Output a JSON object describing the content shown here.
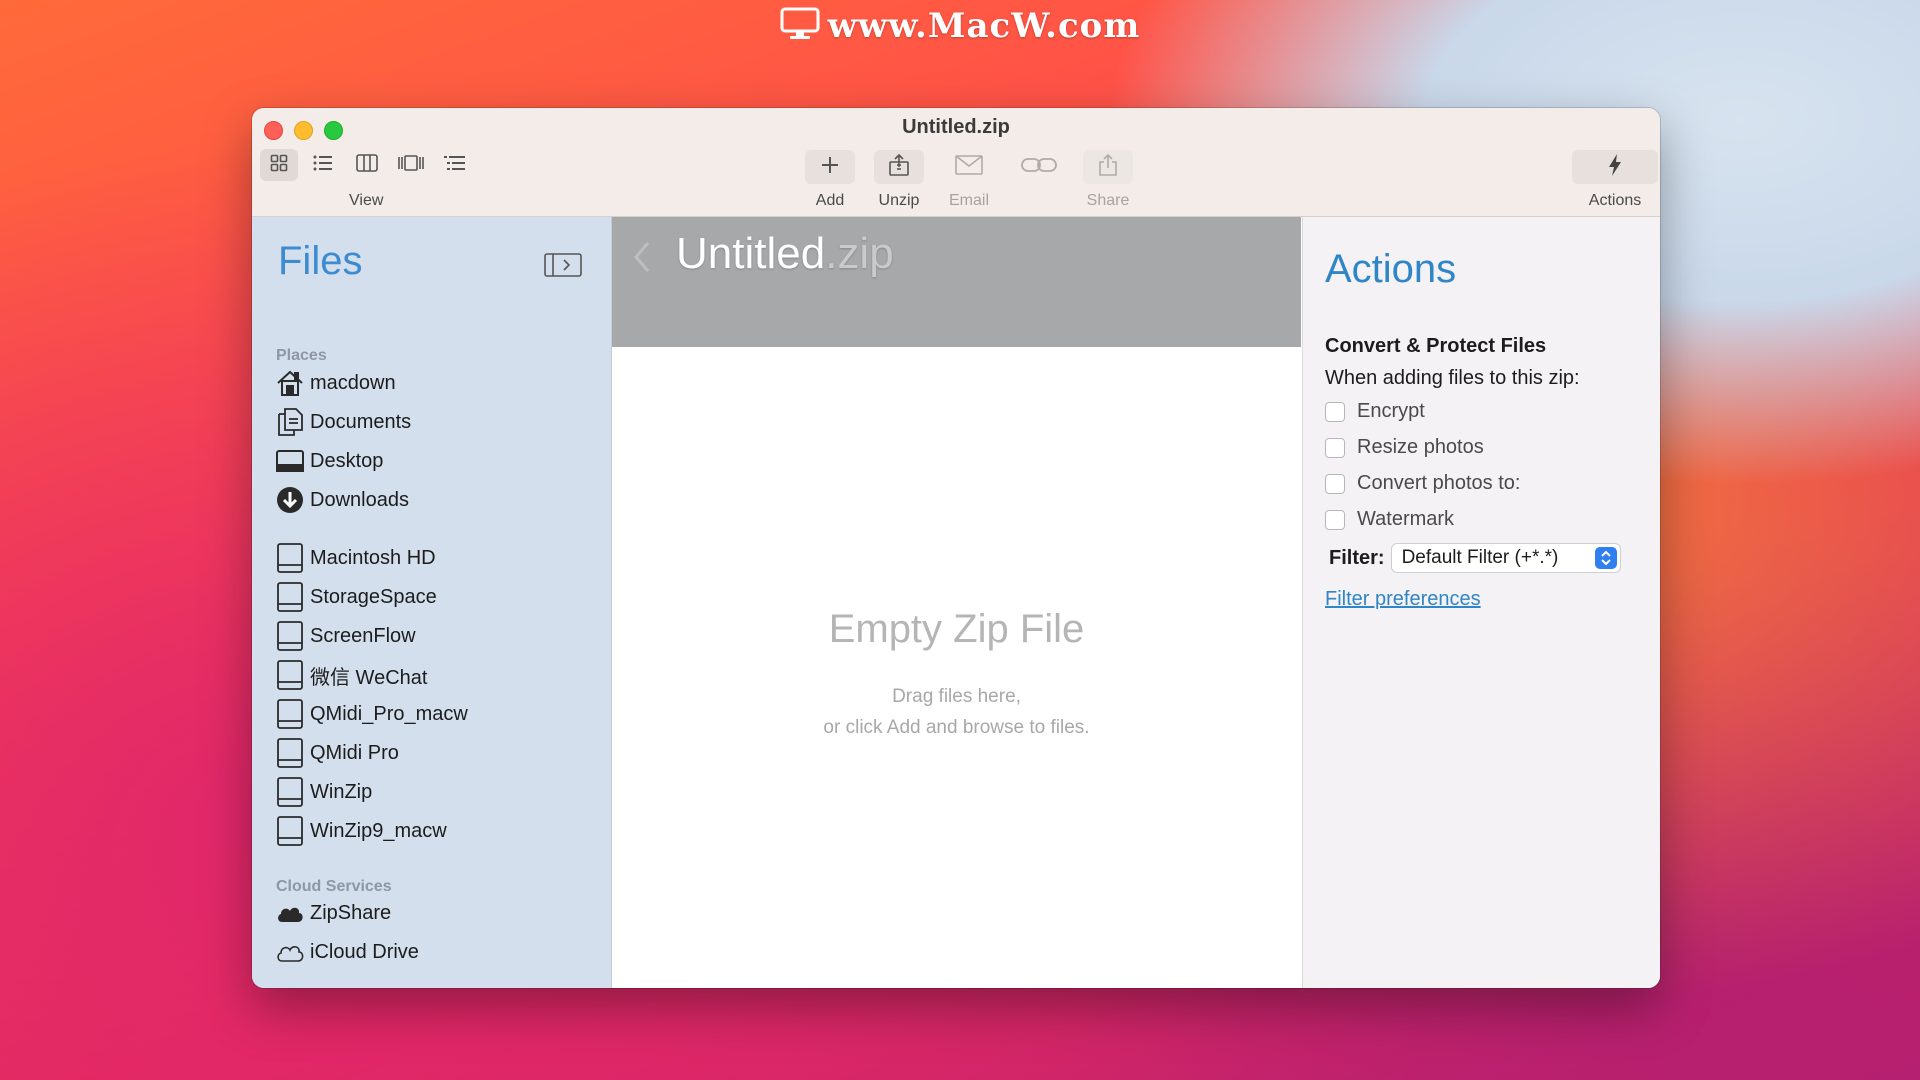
{
  "watermark": {
    "text": "www.MacW.com"
  },
  "window": {
    "title": "Untitled.zip",
    "toolbar": {
      "view_label": "View",
      "add_label": "Add",
      "unzip_label": "Unzip",
      "email_label": "Email",
      "share_label": "Share",
      "actions_label": "Actions"
    }
  },
  "sidebar": {
    "title": "Files",
    "places_header": "Places",
    "places": [
      {
        "label": "macdown",
        "icon": "home-icon"
      },
      {
        "label": "Documents",
        "icon": "documents-icon"
      },
      {
        "label": "Desktop",
        "icon": "desktop-icon"
      },
      {
        "label": "Downloads",
        "icon": "downloads-icon"
      }
    ],
    "volumes": [
      {
        "label": "Macintosh HD",
        "icon": "drive-icon"
      },
      {
        "label": "StorageSpace",
        "icon": "drive-icon"
      },
      {
        "label": "ScreenFlow",
        "icon": "drive-icon"
      },
      {
        "label": "微信 WeChat",
        "icon": "drive-icon"
      },
      {
        "label": "QMidi_Pro_macw",
        "icon": "drive-icon"
      },
      {
        "label": "QMidi Pro",
        "icon": "drive-icon"
      },
      {
        "label": "WinZip",
        "icon": "drive-icon"
      },
      {
        "label": "WinZip9_macw",
        "icon": "drive-icon"
      }
    ],
    "cloud_header": "Cloud Services",
    "cloud": [
      {
        "label": "ZipShare",
        "icon": "cloud-filled-icon"
      },
      {
        "label": "iCloud Drive",
        "icon": "cloud-outline-icon"
      }
    ]
  },
  "content": {
    "zip_base": "Untitled",
    "zip_ext": ".zip",
    "empty_title": "Empty Zip File",
    "empty_line1": "Drag files here,",
    "empty_line2": "or click Add and browse to files."
  },
  "actions": {
    "title": "Actions",
    "section_title": "Convert & Protect Files",
    "section_sub": "When adding files to this zip:",
    "options": [
      "Encrypt",
      "Resize photos",
      "Convert photos to:",
      "Watermark"
    ],
    "filter_label": "Filter:",
    "filter_value": "Default Filter (+*.*)",
    "filter_link": "Filter preferences"
  },
  "colors": {
    "accent_blue": "#2f86c6",
    "sidebar_bg": "#d4dfee",
    "titlebar_bg": "#f4ece9"
  }
}
